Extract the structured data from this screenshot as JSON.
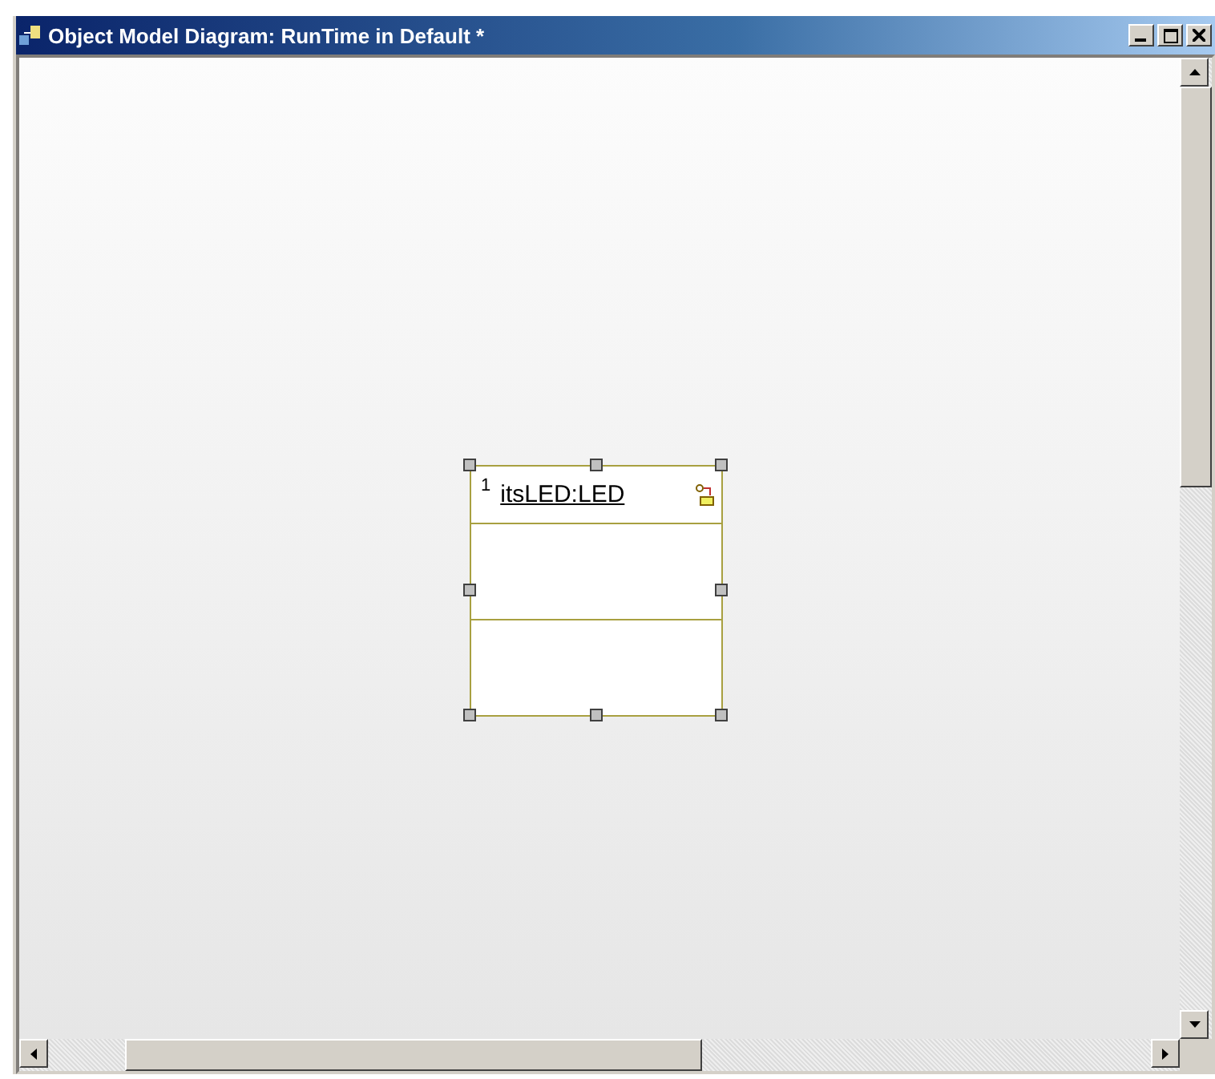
{
  "window": {
    "title": "Object Model Diagram: RunTime in Default *"
  },
  "diagram": {
    "objects": [
      {
        "multiplicity": "1",
        "name": "itsLED:LED",
        "selected": true
      }
    ]
  }
}
